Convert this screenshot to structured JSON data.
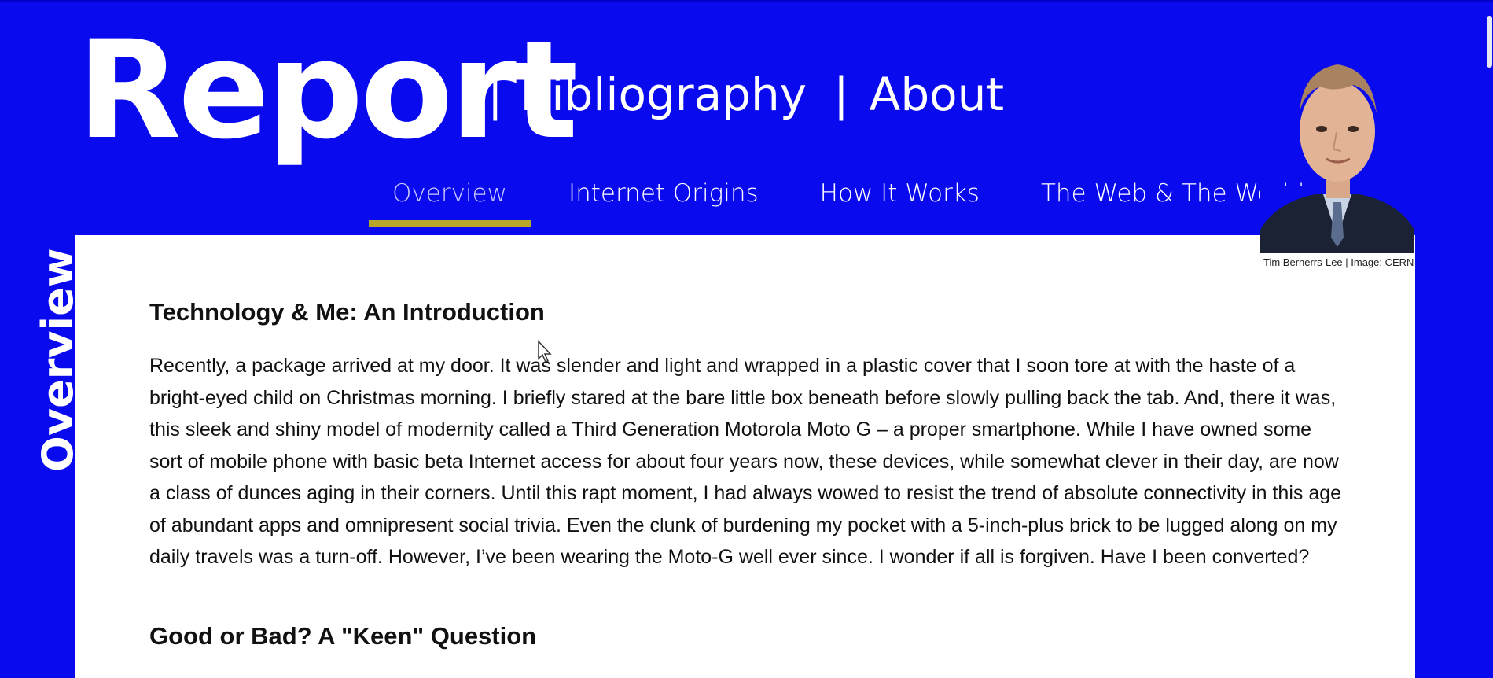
{
  "header": {
    "logo": "Report",
    "sep1": "|",
    "bibliography_label": "Bibliography",
    "sep2": "|",
    "about_label": "About"
  },
  "tabs": [
    {
      "label": "Overview",
      "active": true
    },
    {
      "label": "Internet Origins",
      "active": false
    },
    {
      "label": "How It Works",
      "active": false
    },
    {
      "label": "The Web & The World",
      "active": false
    }
  ],
  "portrait": {
    "caption": "Tim Bernerrs-Lee | Image: CERN"
  },
  "side_label": "Overview",
  "article": {
    "heading1": "Technology & Me: An Introduction",
    "paragraph1": "Recently, a package arrived at my door. It was slender and light and wrapped in a plastic cover that I soon tore at with the haste of a bright-eyed child on Christmas morning. I briefly stared at the bare little box beneath before slowly pulling back the tab. And, there it was, this sleek and shiny model of modernity called a Third Generation Motorola Moto G – a proper smartphone. While I have owned some sort of mobile phone with basic beta Internet access for about four years now, these devices, while somewhat clever in their day, are now a class of dunces aging in their corners. Until this rapt moment, I had always wowed to resist the trend of absolute connectivity in this age of abundant apps and omnipresent social trivia. Even the clunk of burdening my pocket with a 5-inch-plus brick to be lugged along on my daily travels was a turn-off. However, I’ve been wearing the Moto-G well ever since. I wonder if all is forgiven. Have I been converted?",
    "heading2": "Good or Bad? A \"Keen\" Question"
  },
  "colors": {
    "page_background": "#0a0aef",
    "active_tab_underline": "#b8a62a",
    "content_background": "#ffffff"
  }
}
